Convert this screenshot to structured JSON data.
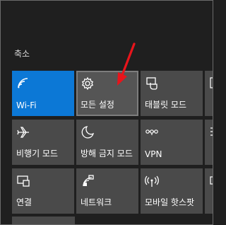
{
  "action_center": {
    "collapse_label": "축소",
    "tiles": [
      {
        "label": "Wi-Fi",
        "icon": "wifi-icon",
        "state": "on"
      },
      {
        "label": "모든 설정",
        "icon": "gear-icon",
        "state": "hover"
      },
      {
        "label": "태블릿 모드",
        "icon": "tablet-mode-icon",
        "state": "off"
      },
      {
        "label": "비행기 모드",
        "icon": "airplane-icon",
        "state": "off"
      },
      {
        "label": "방해 금지 모드",
        "icon": "moon-icon",
        "state": "off"
      },
      {
        "label": "VPN",
        "icon": "vpn-icon",
        "state": "off"
      },
      {
        "label": "연결",
        "icon": "connect-icon",
        "state": "off"
      },
      {
        "label": "네트워크",
        "icon": "network-icon",
        "state": "off"
      },
      {
        "label": "모바일 핫스팟",
        "icon": "hotspot-icon",
        "state": "off"
      }
    ]
  },
  "colors": {
    "background": "#1f1f1f",
    "tile_off": "#4a4a4a",
    "tile_on": "#0c78d6",
    "annotation_arrow": "#e8141b"
  }
}
